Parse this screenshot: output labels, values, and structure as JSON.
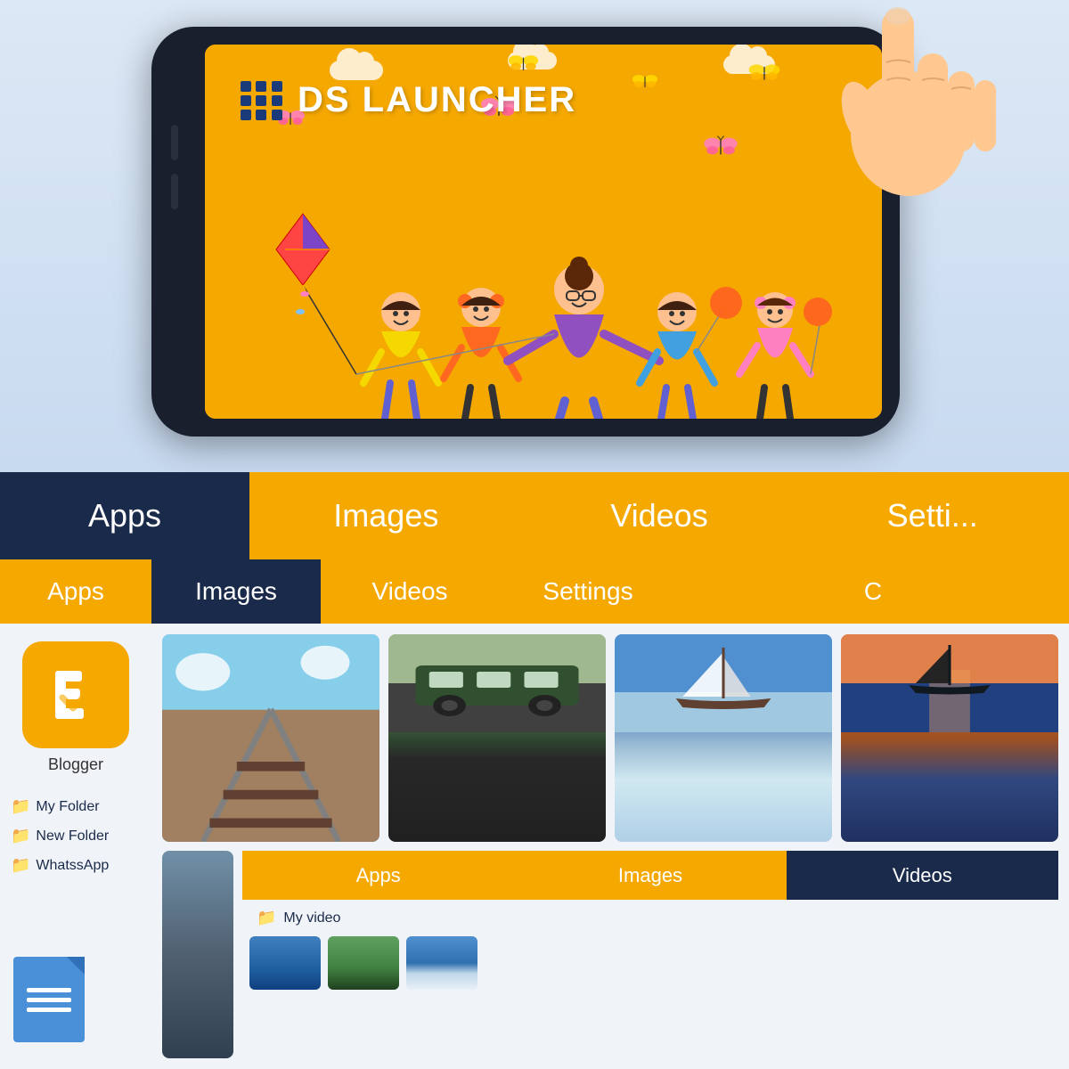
{
  "app": {
    "name": "DS Launcher",
    "title": "DS LAUNCHER"
  },
  "phone": {
    "logo_text": "DS LAUNCHER"
  },
  "tabs": {
    "row1": [
      {
        "label": "Apps",
        "active": true,
        "style": "dark"
      },
      {
        "label": "Images",
        "active": false,
        "style": "orange"
      },
      {
        "label": "Videos",
        "active": false,
        "style": "orange"
      },
      {
        "label": "Setti...",
        "active": false,
        "style": "orange"
      }
    ],
    "row2": [
      {
        "label": "Apps",
        "active": false,
        "style": "orange"
      },
      {
        "label": "Images",
        "active": true,
        "style": "dark"
      },
      {
        "label": "Videos",
        "active": false,
        "style": "orange"
      },
      {
        "label": "Settings",
        "active": false,
        "style": "orange"
      }
    ],
    "row3": [
      {
        "label": "Apps",
        "active": false,
        "style": "orange"
      },
      {
        "label": "Images",
        "active": false,
        "style": "orange"
      },
      {
        "label": "Videos",
        "active": true,
        "style": "dark"
      }
    ]
  },
  "folders": [
    {
      "name": "My Folder"
    },
    {
      "name": "New Folder"
    },
    {
      "name": "WhatssApp"
    }
  ],
  "apps": [
    {
      "name": "Blogger",
      "icon_color": "#f5a800"
    }
  ],
  "images": [
    {
      "id": "railway",
      "type": "railway"
    },
    {
      "id": "train",
      "type": "train"
    },
    {
      "id": "sailboat",
      "type": "sailboat"
    },
    {
      "id": "sailboat2",
      "type": "sailboat2"
    }
  ],
  "video_section": {
    "label": "My video"
  }
}
